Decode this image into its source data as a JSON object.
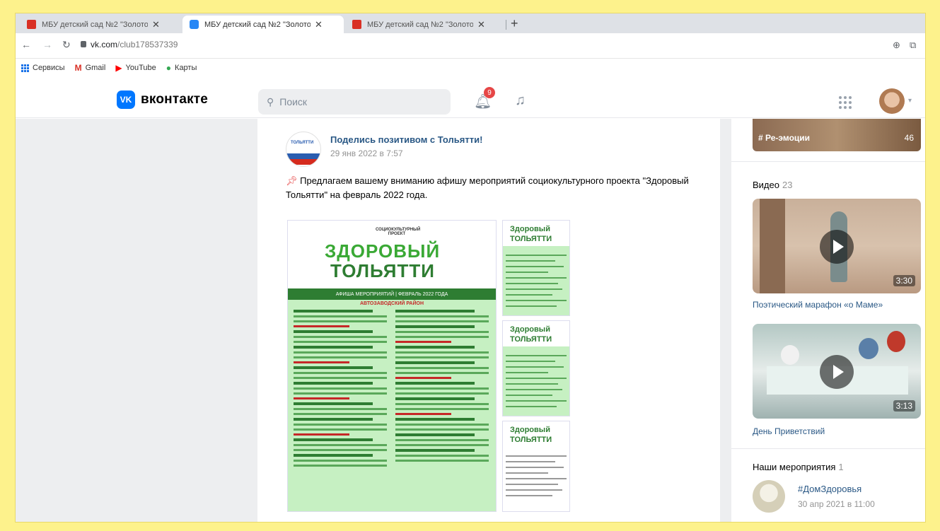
{
  "browser": {
    "tabs": [
      {
        "title": "МБУ детский сад №2 \"Золотой",
        "active": false
      },
      {
        "title": "МБУ детский сад №2 \"Золотой",
        "active": true
      },
      {
        "title": "МБУ детский сад №2 \"Золотой",
        "active": false
      }
    ],
    "url_host": "vk.com",
    "url_path": "/club178537339",
    "bookmarks": [
      "Сервисы",
      "Gmail",
      "YouTube",
      "Карты"
    ]
  },
  "vk": {
    "logo_text": "вконтакте",
    "logo_mark": "VK",
    "search_placeholder": "Поиск",
    "notification_count": "9"
  },
  "post": {
    "author": "Поделись позитивом с Тольятти!",
    "date": "29 янв 2022 в 7:57",
    "text": "Предлагаем вашему вниманию афишу мероприятий социокультурного проекта \"Здоровый Тольятти\" на февраль 2022 года.",
    "poster": {
      "subtitle": "СОЦИОКУЛЬТУРНЫЙ ПРОЕКТ",
      "title_line1": "ЗДОРОВЫЙ",
      "title_line2": "ТОЛЬЯТТИ",
      "banner": "АФИША МЕРОПРИЯТИЙ | ФЕВРАЛЬ 2022 ГОДА",
      "district": "АВТОЗАВОДСКИЙ РАЙОН"
    },
    "thumb_title1": "Здоровый",
    "thumb_title2": "ТОЛЬЯТТИ"
  },
  "sidebar": {
    "photo_tag": "# Ре-эмоции",
    "photo_count": "46",
    "videos_label": "Видео",
    "videos_count": "23",
    "videos": [
      {
        "title": "Поэтический марафон «о Маме»",
        "duration": "3:30"
      },
      {
        "title": "День Приветствий",
        "duration": "3:13"
      }
    ],
    "events_label": "Наши мероприятия",
    "events_count": "1",
    "event": {
      "name": "#ДомЗдоровья",
      "date": "30 апр 2021 в 11:00"
    }
  }
}
